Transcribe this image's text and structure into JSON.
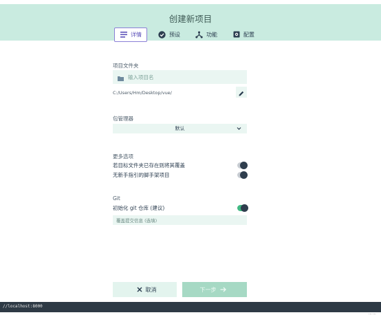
{
  "header": {
    "title": "创建新项目",
    "tabs": [
      {
        "label": "详情",
        "icon": "list-icon",
        "active": true
      },
      {
        "label": "预设",
        "icon": "check-circle-icon",
        "active": false
      },
      {
        "label": "功能",
        "icon": "fork-icon",
        "active": false
      },
      {
        "label": "配置",
        "icon": "settings-icon",
        "active": false
      }
    ]
  },
  "project_folder": {
    "label": "项目文件夹",
    "input_placeholder": "输入项目名",
    "path": "C:/Users/Hm/Desktop/vue/"
  },
  "package_manager": {
    "label": "包管理器",
    "selected": "默认"
  },
  "more_options": {
    "label": "更多选项",
    "toggles": [
      {
        "label": "若目标文件夹已存在则将其覆盖",
        "on": false
      },
      {
        "label": "无新手指引的脚手架项目",
        "on": false
      }
    ]
  },
  "git": {
    "label": "Git",
    "init_label": "初始化 git 仓库 (建议)",
    "init_on": true,
    "commit_placeholder": "覆盖提交信息 (选填)"
  },
  "footer": {
    "cancel_label": "取消",
    "next_label": "下一步"
  },
  "statusbar": {
    "url": "//localhost:8000"
  },
  "colors": {
    "header_bg": "#c9ebe0",
    "field_bg": "#eaf6f2",
    "accent_green": "#42b983",
    "active_tab_border": "#8a7fd6"
  }
}
